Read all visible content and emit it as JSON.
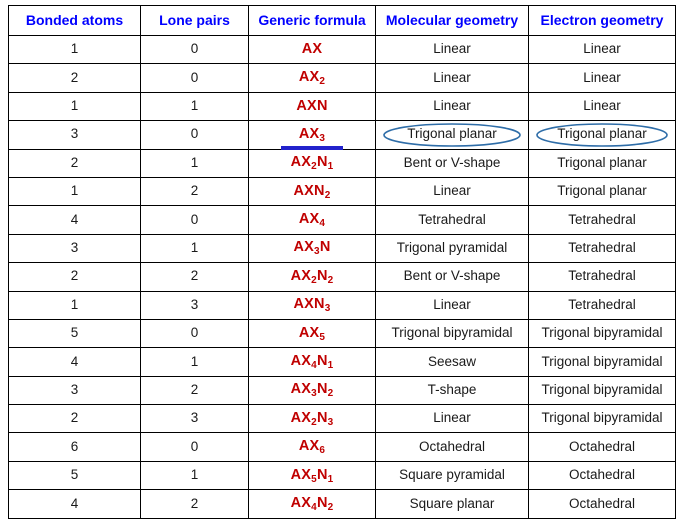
{
  "table": {
    "headers": [
      "Bonded atoms",
      "Lone pairs",
      "Generic formula",
      "Molecular geometry",
      "Electron geometry"
    ],
    "rows": [
      {
        "bonded": "1",
        "lone": "0",
        "formula_main": "AX",
        "formula_sub1": "",
        "formula_mid": "",
        "formula_sub2": "",
        "molecular": "Linear",
        "electron": "Linear"
      },
      {
        "bonded": "2",
        "lone": "0",
        "formula_main": "AX",
        "formula_sub1": "2",
        "formula_mid": "",
        "formula_sub2": "",
        "molecular": "Linear",
        "electron": "Linear"
      },
      {
        "bonded": "1",
        "lone": "1",
        "formula_main": "AX",
        "formula_sub1": "",
        "formula_mid": "N",
        "formula_sub2": "",
        "molecular": "Linear",
        "electron": "Linear"
      },
      {
        "bonded": "3",
        "lone": "0",
        "formula_main": "AX",
        "formula_sub1": "3",
        "formula_mid": "",
        "formula_sub2": "",
        "molecular": "Trigonal planar",
        "electron": "Trigonal planar"
      },
      {
        "bonded": "2",
        "lone": "1",
        "formula_main": "AX",
        "formula_sub1": "2",
        "formula_mid": "N",
        "formula_sub2": "1",
        "molecular": "Bent or V-shape",
        "electron": "Trigonal planar"
      },
      {
        "bonded": "1",
        "lone": "2",
        "formula_main": "AX",
        "formula_sub1": "",
        "formula_mid": "N",
        "formula_sub2": "2",
        "molecular": "Linear",
        "electron": "Trigonal planar"
      },
      {
        "bonded": "4",
        "lone": "0",
        "formula_main": "AX",
        "formula_sub1": "4",
        "formula_mid": "",
        "formula_sub2": "",
        "molecular": "Tetrahedral",
        "electron": "Tetrahedral"
      },
      {
        "bonded": "3",
        "lone": "1",
        "formula_main": "AX",
        "formula_sub1": "3",
        "formula_mid": "N",
        "formula_sub2": "",
        "molecular": "Trigonal pyramidal",
        "electron": "Tetrahedral"
      },
      {
        "bonded": "2",
        "lone": "2",
        "formula_main": "AX",
        "formula_sub1": "2",
        "formula_mid": "N",
        "formula_sub2": "2",
        "molecular": "Bent or V-shape",
        "electron": "Tetrahedral"
      },
      {
        "bonded": "1",
        "lone": "3",
        "formula_main": "AX",
        "formula_sub1": "",
        "formula_mid": "N",
        "formula_sub2": "3",
        "molecular": "Linear",
        "electron": "Tetrahedral"
      },
      {
        "bonded": "5",
        "lone": "0",
        "formula_main": "AX",
        "formula_sub1": "5",
        "formula_mid": "",
        "formula_sub2": "",
        "molecular": "Trigonal bipyramidal",
        "electron": "Trigonal bipyramidal"
      },
      {
        "bonded": "4",
        "lone": "1",
        "formula_main": "AX",
        "formula_sub1": "4",
        "formula_mid": "N",
        "formula_sub2": "1",
        "molecular": "Seesaw",
        "electron": "Trigonal bipyramidal"
      },
      {
        "bonded": "3",
        "lone": "2",
        "formula_main": "AX",
        "formula_sub1": "3",
        "formula_mid": "N",
        "formula_sub2": "2",
        "molecular": "T-shape",
        "electron": "Trigonal bipyramidal"
      },
      {
        "bonded": "2",
        "lone": "3",
        "formula_main": "AX",
        "formula_sub1": "2",
        "formula_mid": "N",
        "formula_sub2": "3",
        "molecular": "Linear",
        "electron": "Trigonal bipyramidal"
      },
      {
        "bonded": "6",
        "lone": "0",
        "formula_main": "AX",
        "formula_sub1": "6",
        "formula_mid": "",
        "formula_sub2": "",
        "molecular": "Octahedral",
        "electron": "Octahedral"
      },
      {
        "bonded": "5",
        "lone": "1",
        "formula_main": "AX",
        "formula_sub1": "5",
        "formula_mid": "N",
        "formula_sub2": "1",
        "molecular": "Square pyramidal",
        "electron": "Octahedral"
      },
      {
        "bonded": "4",
        "lone": "2",
        "formula_main": "AX",
        "formula_sub1": "4",
        "formula_mid": "N",
        "formula_sub2": "2",
        "molecular": "Square planar",
        "electron": "Octahedral"
      }
    ],
    "annotations": {
      "underlined_formula_row_index": 3,
      "circled_cells": [
        "row3-molecular",
        "row3-electron"
      ],
      "underline_color": "#2222cc",
      "ellipse_color": "#2e6da8",
      "header_color": "#0000ff",
      "formula_color": "#c00000",
      "body_text_color": "#1a1a1a",
      "border_color": "#000000"
    }
  }
}
